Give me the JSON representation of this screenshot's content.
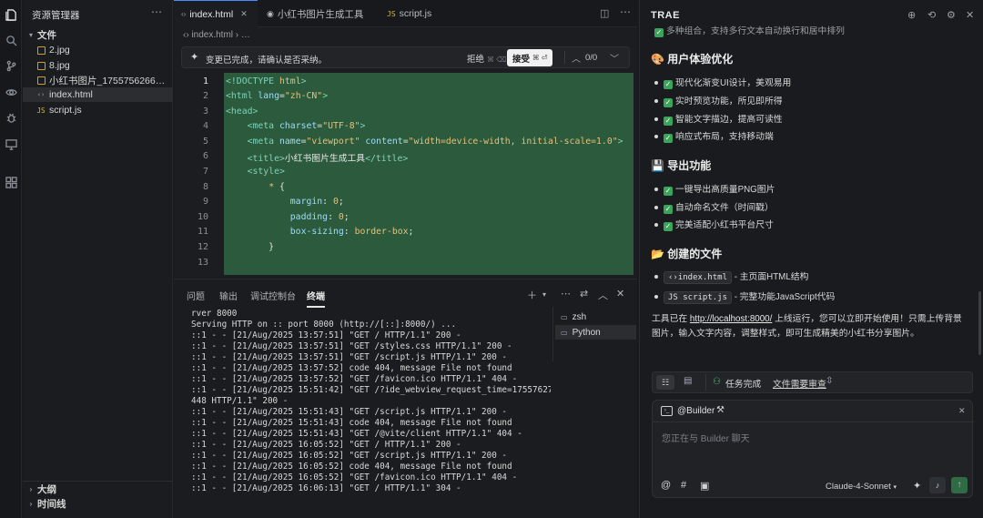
{
  "explorer": {
    "title": "资源管理器",
    "more": "⋯",
    "folder": "文件",
    "files": [
      "2.jpg",
      "8.jpg",
      "小红书图片_1755756266422.jpg",
      "index.html",
      "script.js"
    ],
    "outline": "大纲",
    "timeline": "时间线"
  },
  "tabs": [
    {
      "label": "index.html",
      "icon": "‹›"
    },
    {
      "label": "小红书图片生成工具",
      "icon": "◉"
    },
    {
      "label": "script.js",
      "icon": "JS"
    }
  ],
  "breadcrumb": "‹› index.html  ›  …",
  "banner": {
    "message": "变更已完成，请确认是否采纳。",
    "reject": "拒绝",
    "reject_kbd": "⌘ ⌫",
    "accept": "接受",
    "accept_kbd": "⌘ ⏎",
    "count": "0/0"
  },
  "code_lines": [
    "1",
    "2",
    "3",
    "4",
    "5",
    "6",
    "7",
    "8",
    "9",
    "10",
    "11",
    "12",
    "13"
  ],
  "panel": {
    "tabs": [
      "问题",
      "输出",
      "调试控制台",
      "终端"
    ],
    "terminals": [
      "zsh",
      "Python"
    ]
  },
  "terminal_lines": [
    "rver 8000",
    "Serving HTTP on :: port 8000 (http://[::]:8000/) ...",
    "::1 - - [21/Aug/2025 13:57:51] \"GET / HTTP/1.1\" 200 -",
    "::1 - - [21/Aug/2025 13:57:51] \"GET /styles.css HTTP/1.1\" 200 -",
    "::1 - - [21/Aug/2025 13:57:51] \"GET /script.js HTTP/1.1\" 200 -",
    "::1 - - [21/Aug/2025 13:57:52] code 404, message File not found",
    "::1 - - [21/Aug/2025 13:57:52] \"GET /favicon.ico HTTP/1.1\" 404 -",
    "::1 - - [21/Aug/2025 15:51:42] \"GET /?ide_webview_request_time=1755762702",
    "448 HTTP/1.1\" 200 -",
    "::1 - - [21/Aug/2025 15:51:43] \"GET /script.js HTTP/1.1\" 200 -",
    "::1 - - [21/Aug/2025 15:51:43] code 404, message File not found",
    "::1 - - [21/Aug/2025 15:51:43] \"GET /@vite/client HTTP/1.1\" 404 -",
    "::1 - - [21/Aug/2025 16:05:52] \"GET / HTTP/1.1\" 200 -",
    "::1 - - [21/Aug/2025 16:05:52] \"GET /script.js HTTP/1.1\" 200 -",
    "::1 - - [21/Aug/2025 16:05:52] code 404, message File not found",
    "::1 - - [21/Aug/2025 16:05:52] \"GET /favicon.ico HTTP/1.1\" 404 -",
    "::1 - - [21/Aug/2025 16:06:13] \"GET / HTTP/1.1\" 304 -"
  ],
  "trae": {
    "title": "TRAE",
    "top_cut": "多种组合，支持多行文本自动换行和居中排列",
    "ux_heading": "🎨 用户体验优化",
    "ux_items": [
      "现代化渐变UI设计，美观易用",
      "实时预览功能，所见即所得",
      "智能文字描边，提高可读性",
      "响应式布局，支持移动端"
    ],
    "export_heading": "💾 导出功能",
    "export_items": [
      "一键导出高质量PNG图片",
      "自动命名文件（时间戳）",
      "完美适配小红书平台尺寸"
    ],
    "files_heading": "📂 创建的文件",
    "file_items": [
      {
        "tag": "‹›index.html",
        "desc": " - 主页面HTML结构"
      },
      {
        "tag": "JS script.js",
        "desc": " - 完整功能JavaScript代码"
      }
    ],
    "para_1": "工具已在 ",
    "url": "http://localhost:8000/",
    "para_2": " 上线运行，您可以立即开始使用！只需上传背景图片，输入文字内容，调整样式，即可生成精美的小红书分享图片。",
    "task_done": "任务完成",
    "task_review": "文件需要审查",
    "builder": "@Builder",
    "chat_placeholder": "您正在与 Builder 聊天",
    "model": "Claude-4-Sonnet"
  }
}
